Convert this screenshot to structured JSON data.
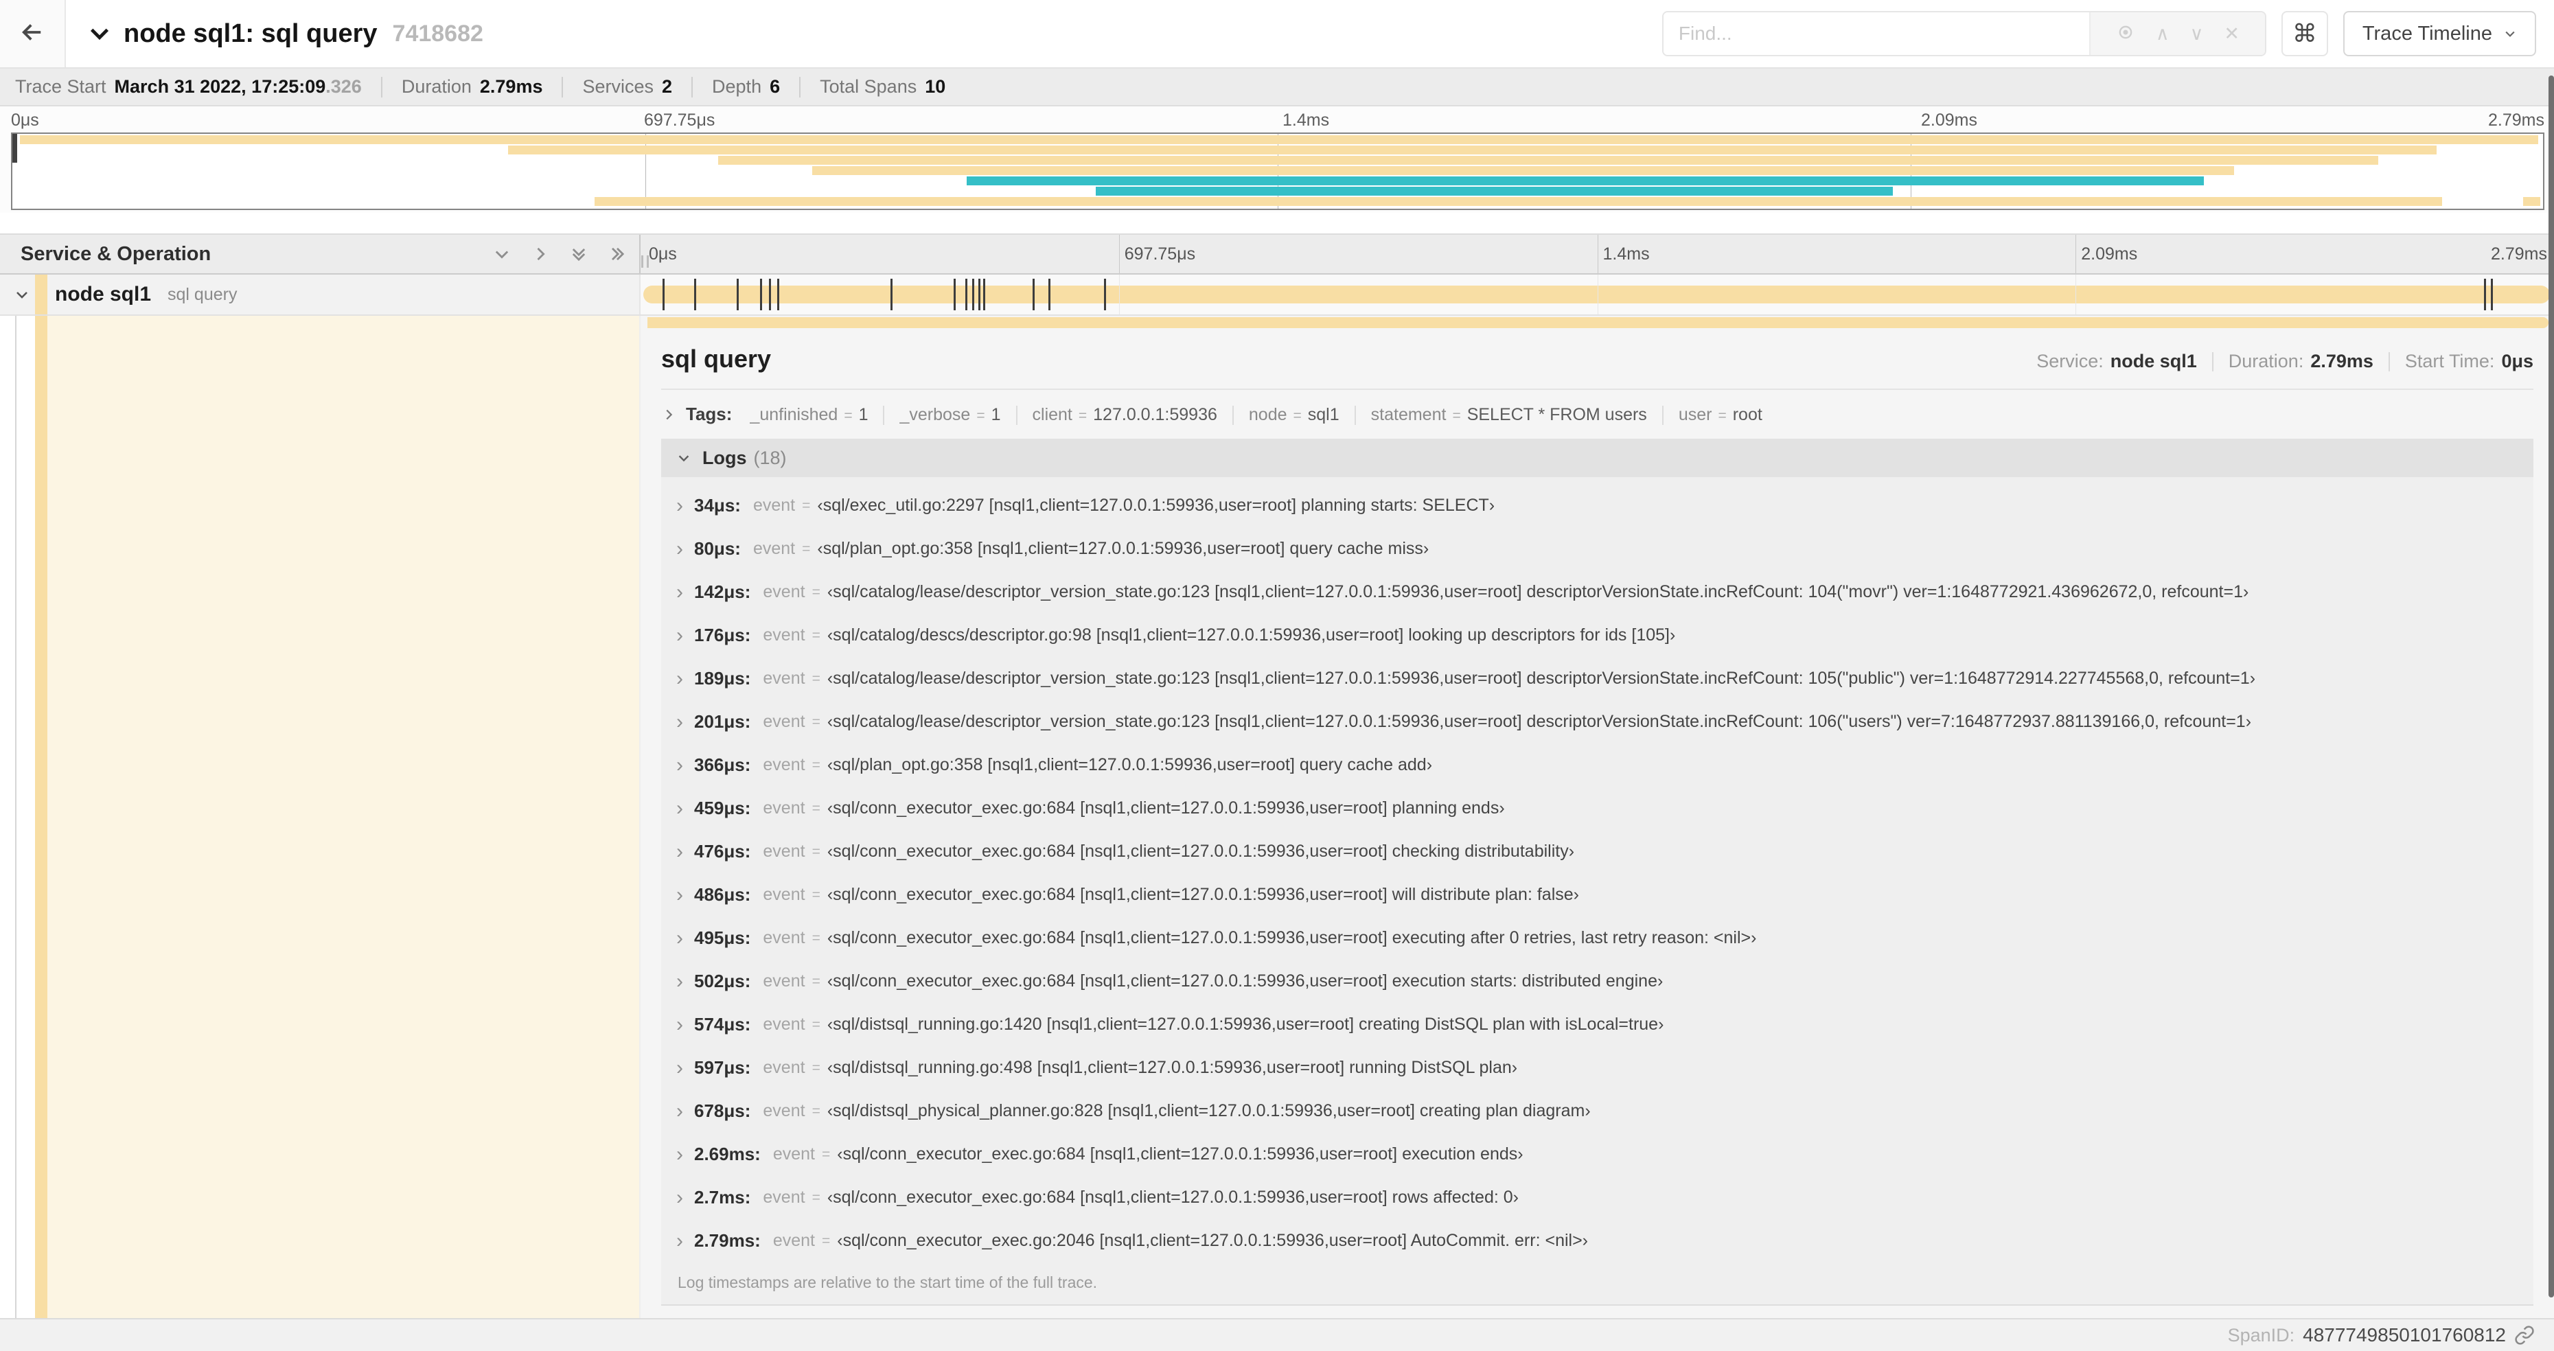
{
  "header": {
    "title": "node sql1: sql query",
    "trace_id": "7418682",
    "find_placeholder": "Find...",
    "shortcut_key": "⌘",
    "view_selector": "Trace Timeline"
  },
  "summary": {
    "items": [
      {
        "label": "Trace Start",
        "value": "March 31 2022, 17:25:09",
        "extra": ".326"
      },
      {
        "label": "Duration",
        "value": "2.79ms"
      },
      {
        "label": "Services",
        "value": "2"
      },
      {
        "label": "Depth",
        "value": "6"
      },
      {
        "label": "Total Spans",
        "value": "10"
      }
    ]
  },
  "minimap": {
    "ticks": [
      "0μs",
      "697.75μs",
      "1.4ms",
      "2.09ms",
      "2.79ms"
    ],
    "bars": [
      {
        "row": 0,
        "start": 0.3,
        "end": 99.8,
        "color": "tan"
      },
      {
        "row": 1,
        "start": 19.6,
        "end": 95.8,
        "color": "tan"
      },
      {
        "row": 2,
        "start": 27.9,
        "end": 93.5,
        "color": "tan"
      },
      {
        "row": 3,
        "start": 31.6,
        "end": 87.8,
        "color": "tan"
      },
      {
        "row": 4,
        "start": 37.7,
        "end": 86.6,
        "color": "teal"
      },
      {
        "row": 5,
        "start": 42.8,
        "end": 74.3,
        "color": "teal"
      },
      {
        "row": 6,
        "start": 23.0,
        "end": 96.0,
        "color": "tan"
      },
      {
        "row": 6,
        "start": 99.2,
        "end": 99.9,
        "color": "tan"
      }
    ]
  },
  "timeline": {
    "header": "Service & Operation",
    "ticks": [
      "0μs",
      "697.75μs",
      "1.4ms",
      "2.09ms",
      "2.79ms"
    ],
    "total_us": 2790,
    "row": {
      "service": "node sql1",
      "operation": "sql query"
    },
    "log_marker_times_us": [
      34,
      80,
      142,
      176,
      189,
      201,
      366,
      459,
      476,
      486,
      495,
      502,
      574,
      597,
      678,
      2690,
      2700,
      2790
    ]
  },
  "detail": {
    "title": "sql query",
    "overview": [
      {
        "label": "Service:",
        "value": "node sql1"
      },
      {
        "label": "Duration:",
        "value": "2.79ms"
      },
      {
        "label": "Start Time:",
        "value": "0μs"
      }
    ],
    "tags": {
      "label": "Tags:",
      "items": [
        {
          "key": "_unfinished",
          "value": "1"
        },
        {
          "key": "_verbose",
          "value": "1"
        },
        {
          "key": "client",
          "value": "127.0.0.1:59936"
        },
        {
          "key": "node",
          "value": "sql1"
        },
        {
          "key": "statement",
          "value": "SELECT * FROM users"
        },
        {
          "key": "user",
          "value": "root"
        }
      ]
    },
    "logs": {
      "label": "Logs",
      "count": "(18)",
      "entries": [
        {
          "time": "34μs:",
          "field": "event",
          "value": "‹sql/exec_util.go:2297 [nsql1,client=127.0.0.1:59936,user=root] planning starts: SELECT›"
        },
        {
          "time": "80μs:",
          "field": "event",
          "value": "‹sql/plan_opt.go:358 [nsql1,client=127.0.0.1:59936,user=root] query cache miss›"
        },
        {
          "time": "142μs:",
          "field": "event",
          "value": "‹sql/catalog/lease/descriptor_version_state.go:123 [nsql1,client=127.0.0.1:59936,user=root] descriptorVersionState.incRefCount: 104(\"movr\") ver=1:1648772921.436962672,0, refcount=1›"
        },
        {
          "time": "176μs:",
          "field": "event",
          "value": "‹sql/catalog/descs/descriptor.go:98 [nsql1,client=127.0.0.1:59936,user=root] looking up descriptors for ids [105]›"
        },
        {
          "time": "189μs:",
          "field": "event",
          "value": "‹sql/catalog/lease/descriptor_version_state.go:123 [nsql1,client=127.0.0.1:59936,user=root] descriptorVersionState.incRefCount: 105(\"public\") ver=1:1648772914.227745568,0, refcount=1›"
        },
        {
          "time": "201μs:",
          "field": "event",
          "value": "‹sql/catalog/lease/descriptor_version_state.go:123 [nsql1,client=127.0.0.1:59936,user=root] descriptorVersionState.incRefCount: 106(\"users\") ver=7:1648772937.881139166,0, refcount=1›"
        },
        {
          "time": "366μs:",
          "field": "event",
          "value": "‹sql/plan_opt.go:358 [nsql1,client=127.0.0.1:59936,user=root] query cache add›"
        },
        {
          "time": "459μs:",
          "field": "event",
          "value": "‹sql/conn_executor_exec.go:684 [nsql1,client=127.0.0.1:59936,user=root] planning ends›"
        },
        {
          "time": "476μs:",
          "field": "event",
          "value": "‹sql/conn_executor_exec.go:684 [nsql1,client=127.0.0.1:59936,user=root] checking distributability›"
        },
        {
          "time": "486μs:",
          "field": "event",
          "value": "‹sql/conn_executor_exec.go:684 [nsql1,client=127.0.0.1:59936,user=root] will distribute plan: false›"
        },
        {
          "time": "495μs:",
          "field": "event",
          "value": "‹sql/conn_executor_exec.go:684 [nsql1,client=127.0.0.1:59936,user=root] executing after 0 retries, last retry reason: <nil>›"
        },
        {
          "time": "502μs:",
          "field": "event",
          "value": "‹sql/conn_executor_exec.go:684 [nsql1,client=127.0.0.1:59936,user=root] execution starts: distributed engine›"
        },
        {
          "time": "574μs:",
          "field": "event",
          "value": "‹sql/distsql_running.go:1420 [nsql1,client=127.0.0.1:59936,user=root] creating DistSQL plan with isLocal=true›"
        },
        {
          "time": "597μs:",
          "field": "event",
          "value": "‹sql/distsql_running.go:498 [nsql1,client=127.0.0.1:59936,user=root] running DistSQL plan›"
        },
        {
          "time": "678μs:",
          "field": "event",
          "value": "‹sql/distsql_physical_planner.go:828 [nsql1,client=127.0.0.1:59936,user=root] creating plan diagram›"
        },
        {
          "time": "2.69ms:",
          "field": "event",
          "value": "‹sql/conn_executor_exec.go:684 [nsql1,client=127.0.0.1:59936,user=root] execution ends›"
        },
        {
          "time": "2.7ms:",
          "field": "event",
          "value": "‹sql/conn_executor_exec.go:684 [nsql1,client=127.0.0.1:59936,user=root] rows affected: 0›"
        },
        {
          "time": "2.79ms:",
          "field": "event",
          "value": "‹sql/conn_executor_exec.go:2046 [nsql1,client=127.0.0.1:59936,user=root] AutoCommit. err: <nil>›"
        }
      ],
      "footer": "Log timestamps are relative to the start time of the full trace."
    },
    "span_id_label": "SpanID:",
    "span_id": "4877749850101760812"
  },
  "colors": {
    "tan": "#F8DEA4",
    "teal": "#35bfc7",
    "cream": "#fcf5e3"
  }
}
